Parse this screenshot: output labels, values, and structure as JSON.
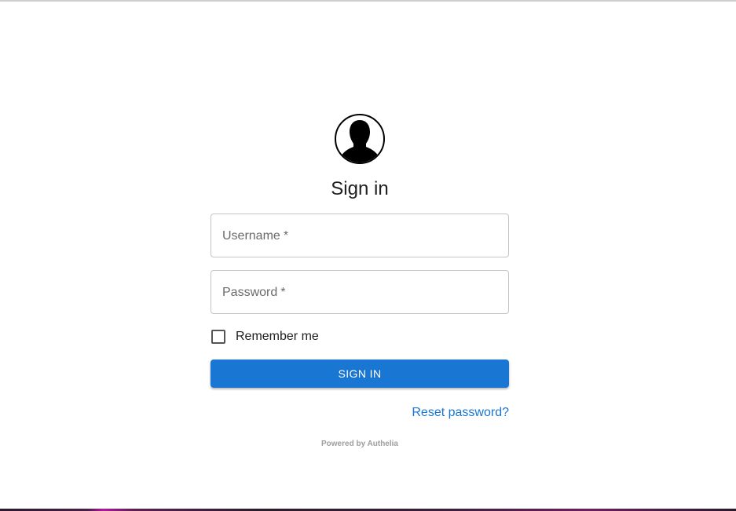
{
  "login": {
    "title": "Sign in",
    "username": {
      "label": "Username",
      "required_mark": "*",
      "value": ""
    },
    "password": {
      "label": "Password",
      "required_mark": "*",
      "value": ""
    },
    "remember_me": {
      "label": "Remember me",
      "checked": false
    },
    "sign_in_button": "SIGN IN",
    "reset_password_link": "Reset password?",
    "powered_by": "Powered by Authelia"
  },
  "icons": {
    "avatar": "user-silhouette-icon",
    "checkbox": "checkbox-unchecked-icon"
  },
  "colors": {
    "accent": "#1976d2",
    "border": "#c4c4c4",
    "muted_text": "#9e9e9e"
  }
}
